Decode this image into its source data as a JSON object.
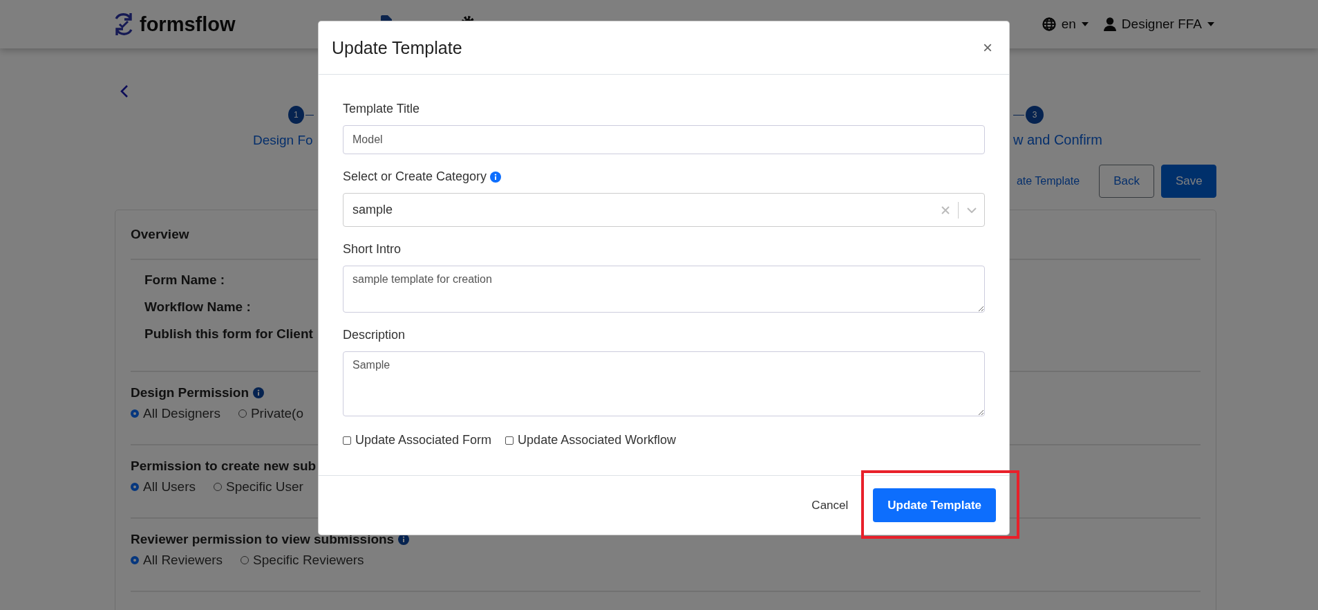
{
  "header": {
    "logo": "formsflow",
    "language": "en",
    "user": "Designer FFA"
  },
  "stepper": {
    "steps": [
      {
        "number": "1",
        "label": "Design Fo"
      },
      {
        "number": "3",
        "label": "w and Confirm"
      }
    ]
  },
  "actions": {
    "link": "ate Template",
    "buttons": [
      {
        "label": "Back",
        "kind": "outline"
      },
      {
        "label": "Save",
        "kind": "primary"
      }
    ]
  },
  "card": {
    "title": "Overview",
    "fields": [
      "Form Name :",
      "Workflow Name :",
      "Publish this form for Client"
    ],
    "sections": [
      {
        "title": "Design Permission",
        "info": true,
        "options": [
          {
            "label": "All Designers",
            "selected": true
          },
          {
            "label": "Private(o",
            "selected": false
          }
        ]
      },
      {
        "title": "Permission to create new sub",
        "info": false,
        "options": [
          {
            "label": "All Users",
            "selected": true
          },
          {
            "label": "Specific User",
            "selected": false
          }
        ]
      },
      {
        "title": "Reviewer permission to view submissions",
        "info": true,
        "options": [
          {
            "label": "All Reviewers",
            "selected": true
          },
          {
            "label": "Specific Reviewers",
            "selected": false
          }
        ]
      }
    ]
  },
  "modal": {
    "title": "Update Template",
    "close": "×",
    "fields": [
      {
        "kind": "input",
        "label": "Template Title",
        "info": false,
        "value": "Model"
      },
      {
        "kind": "select",
        "label": "Select or Create Category",
        "info": true,
        "value": "sample"
      },
      {
        "kind": "textarea",
        "label": "Short Intro",
        "info": false,
        "value": "sample template for creation"
      },
      {
        "kind": "textarea",
        "label": "Description",
        "info": false,
        "value": "Sample"
      }
    ],
    "checkboxes": [
      {
        "label": "Update Associated Form",
        "checked": false
      },
      {
        "label": "Update Associated Workflow",
        "checked": false
      }
    ],
    "cancel": "Cancel",
    "submit": "Update Template",
    "highlight": true
  }
}
